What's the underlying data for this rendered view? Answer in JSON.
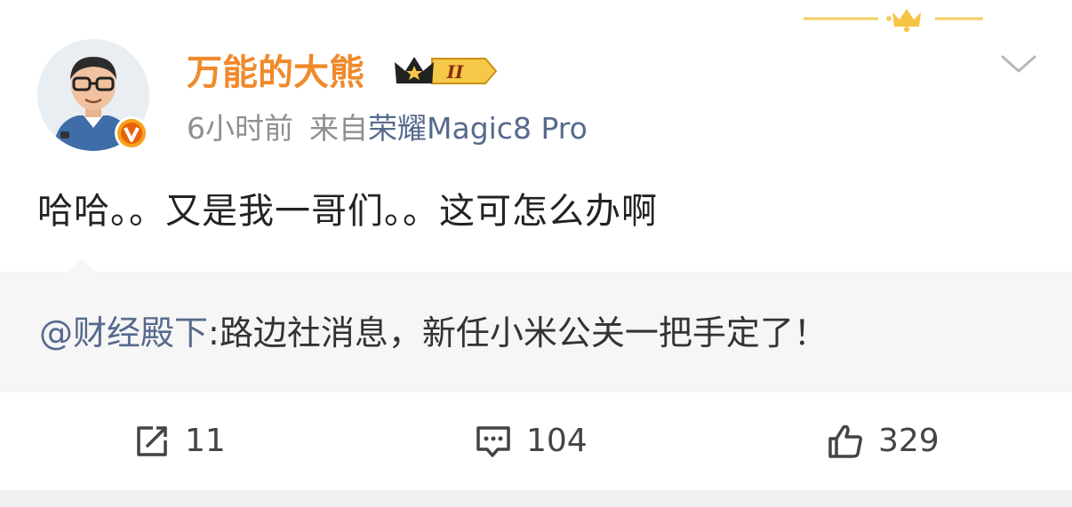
{
  "post": {
    "author": "万能的大熊",
    "vip_level": "II",
    "time": "6小时前",
    "source_prefix": "来自",
    "source_device": "荣耀Magic8 Pro",
    "text": "哈哈。。又是我一哥们。。这可怎么办啊"
  },
  "repost": {
    "mention": "@财经殿下",
    "text": ":路边社消息，新任小米公关一把手定了！"
  },
  "actions": {
    "share_count": "11",
    "comment_count": "104",
    "like_count": "329"
  },
  "icons": {
    "menu": "chevron-down-icon",
    "share": "share-icon",
    "comment": "comment-icon",
    "like": "thumbs-up-icon",
    "verified": "verified-v-badge-icon",
    "vip": "crown-vip-badge-icon"
  },
  "colors": {
    "username": "#f08a2b",
    "link": "#566a8c",
    "meta": "#8f8f8f",
    "verified_badge": "#e8620c",
    "repost_bg": "#f6f6f6"
  }
}
